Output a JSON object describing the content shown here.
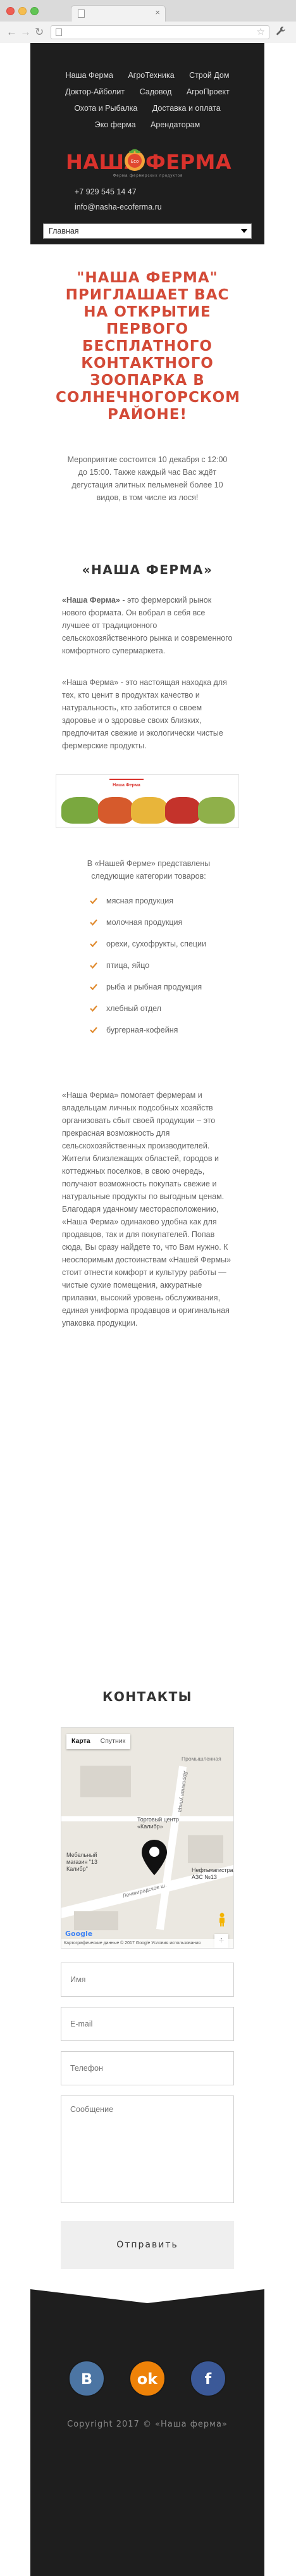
{
  "browser": {
    "tab_close": "×",
    "back": "←",
    "forward": "→",
    "reload": "↻",
    "star": "☆",
    "menu": "🔧"
  },
  "header": {
    "menu_items": [
      "Наша Ферма",
      "АгроТехника",
      "Строй Дом",
      "Доктор-Айболит",
      "Садовод",
      "АгроПроект",
      "Охота и Рыбалка",
      "Доставка и оплата",
      "Эко ферма",
      "Арендаторам"
    ],
    "logo_left": "НАША",
    "logo_right": "ФЕРМА",
    "logo_badge": "Eco",
    "logo_tagline": "Ферма фермерских продуктов",
    "phone": "+7 929 545 14 47",
    "email": "info@nasha-ecoferma.ru",
    "select_value": "Главная"
  },
  "hero": {
    "title": "\"НАША ФЕРМА\" ПРИГЛАШАЕТ ВАС НА ОТКРЫТИЕ ПЕРВОГО БЕСПЛАТНОГО КОНТАКТНОГО ЗООПАРКА В СОЛНЕЧНОГОРСКОМ РАЙОНЕ!",
    "text": "Мероприятие состоится 10 декабря с 12:00 до 15:00. Также каждый час Вас ждёт дегустация элитных пельменей более 10 видов, в том числе из лося!"
  },
  "about": {
    "title": "«НАША ФЕРМА»",
    "para1_strong": "«Наша Ферма»",
    "para1_rest": " - это фермерский рынок нового формата. Он вобрал в себя все лучшее от традиционного сельскохозяйственного рынка и современного комфортного супермаркета.",
    "para2": "«Наша Ферма» - это настоящая находка для тех, кто ценит в продуктах качество и натуральность, кто заботится о своем здоровье и о здоровье своих близких, предпочитая свежие и экологически чистые фермерские продукты.",
    "banner_logo": "Наша Ферма",
    "categories_intro": "В «Нашей Ферме» представлены следующие категории товаров:",
    "categories": [
      "мясная продукция",
      "молочная продукция",
      "орехи, сухофрукты, специи",
      "птица, яйцо",
      "рыба и рыбная продукция",
      "хлебный отдел",
      "бургерная-кофейня"
    ],
    "para3": "«Наша Ферма» помогает фермерам и владельцам личных подсобных хозяйств организовать сбыт своей продукции – это прекрасная возможность для сельскохозяйственных производителей. Жители близлежащих областей, городов и коттеджных поселков, в свою очередь, получают возможность покупать свежие и натуральные продукты по выгодным ценам. Благодаря удачному месторасположению, «Наша Ферма» одинаково удобна как для продавцов, так и для покупателей. Попав сюда, Вы сразу найдете то, что Вам нужно. К неоспоримым достоинствам «Нашей Фермы» стоит отнести комфорт и культуру работы — чистые сухие помещения, аккуратные прилавки, высокий уровень обслуживания, единая униформа продавцов и оригинальная упаковка продукции."
  },
  "contacts": {
    "title": "КОНТАКТЫ",
    "map": {
      "tab_map": "Карта",
      "tab_sat": "Спутник",
      "label_mall": "Торговый центр «Калибр»",
      "label_shop": "Мебельный магазин \"13 Калибр\"",
      "label_gas": "Нефтьмагистраль АЗС №13",
      "label_street1": "Ленинградское ш.",
      "label_street2": "Дорожная улица",
      "label_street3": "Промышленная",
      "zoom_in": "+",
      "zoom_out": "−",
      "google": "Google",
      "footer_text": "Картографические данные © 2017 Google   Условия использования"
    },
    "form": {
      "name_placeholder": "Имя",
      "email_placeholder": "E-mail",
      "phone_placeholder": "Телефон",
      "message_placeholder": "Сообщение",
      "submit": "Отправить"
    }
  },
  "footer": {
    "vk": "В",
    "ok": "ok",
    "fb": "f",
    "copyright": "Copyright 2017 © «Наша ферма»"
  },
  "colors": {
    "accent": "#d34a37",
    "logo_red": "#d9322c",
    "header_bg": "#1e1e1e",
    "check_orange": "#e08a2e"
  }
}
